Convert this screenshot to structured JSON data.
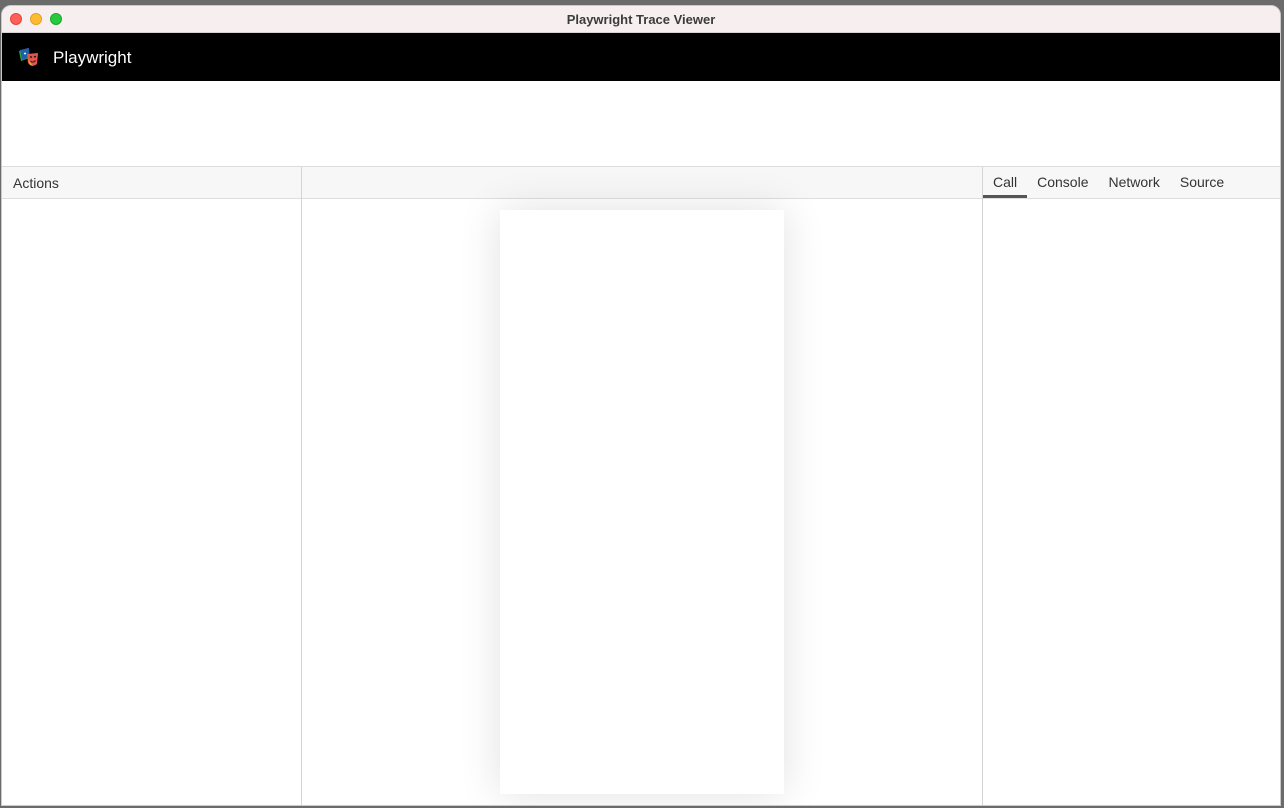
{
  "window": {
    "title": "Playwright Trace Viewer"
  },
  "appbar": {
    "brand": "Playwright",
    "logo_icon": "playwright-logo-icon"
  },
  "actions": {
    "header": "Actions"
  },
  "details": {
    "tabs": [
      {
        "label": "Call",
        "active": true
      },
      {
        "label": "Console",
        "active": false
      },
      {
        "label": "Network",
        "active": false
      },
      {
        "label": "Source",
        "active": false
      }
    ]
  },
  "colors": {
    "appbar_bg": "#000000",
    "titlebar_bg": "#f7efef",
    "close": "#fe5f57",
    "minimize": "#febc2e",
    "maximize": "#28c840"
  }
}
